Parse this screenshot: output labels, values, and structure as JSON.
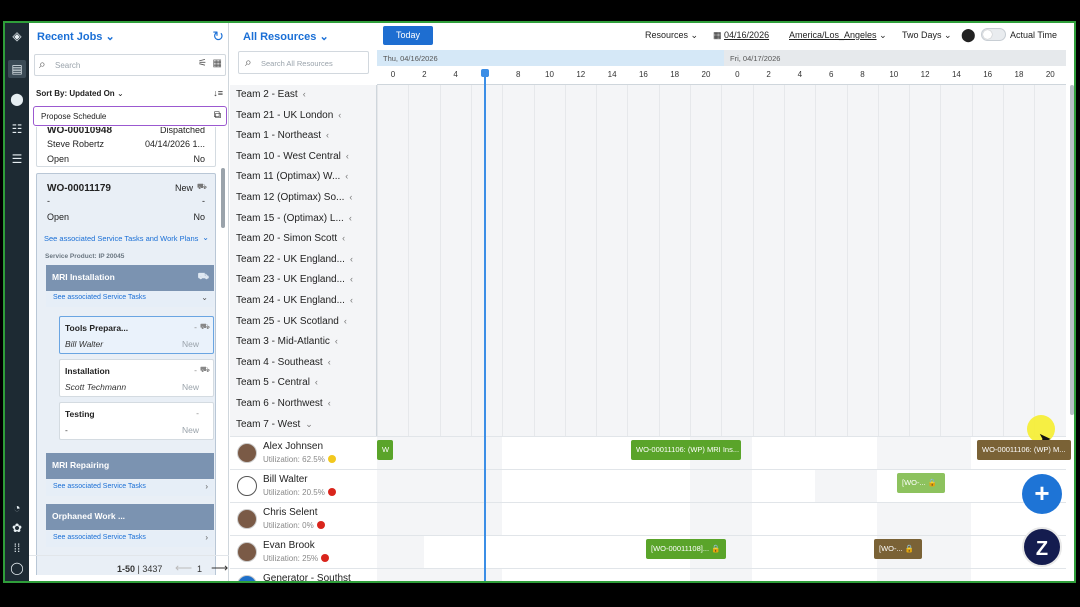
{
  "jobs_panel": {
    "title": "Recent Jobs",
    "search_placeholder": "Search",
    "sort_label": "Sort By:",
    "sort_value": "Updated On",
    "propose_label": "Propose Schedule",
    "jobs": [
      {
        "id": "WO-00010948",
        "status": "Dispatched",
        "person": "Steve Robertz",
        "date": "04/14/2026 1...",
        "state": "Open",
        "flag": "No"
      },
      {
        "id": "WO-00011179",
        "status": "New",
        "person": "-",
        "date": "-",
        "state": "Open",
        "flag": "No"
      }
    ],
    "see_tasks_plans": "See associated Service Tasks and Work Plans",
    "service_product": "Service Product: IP 20045",
    "groups": [
      {
        "name": "MRI Installation",
        "link": "See associated Service Tasks"
      },
      {
        "name": "MRI Repairing",
        "link": "See associated Service Tasks"
      },
      {
        "name": "Orphaned Work ...",
        "link": "See associated Service Tasks"
      }
    ],
    "tasks": [
      {
        "name": "Tools Prepara...",
        "dash": "-",
        "person": "Bill Walter",
        "status": "New"
      },
      {
        "name": "Installation",
        "dash": "-",
        "person": "Scott Techmann",
        "status": "New"
      },
      {
        "name": "Testing",
        "dash": "-",
        "person": "-",
        "status": "New"
      }
    ],
    "pagination": {
      "range": "1-50",
      "total": "3437",
      "page": "1"
    }
  },
  "schedule": {
    "title": "All Resources",
    "today_label": "Today",
    "resources_label": "Resources",
    "date": "04/16/2026",
    "timezone": "America/Los_Angeles",
    "view": "Two Days",
    "actual_time": "Actual Time",
    "search_placeholder": "Search All Resources",
    "day1": "Thu, 04/16/2026",
    "day2": "Fri, 04/17/2026",
    "hours": [
      "0",
      "2",
      "4",
      "6",
      "8",
      "10",
      "12",
      "14",
      "16",
      "18",
      "20",
      "0",
      "2",
      "4",
      "6",
      "8",
      "10",
      "12",
      "14",
      "16",
      "18",
      "20"
    ],
    "teams": [
      "Team 2 - East",
      "Team 21 - UK London",
      "Team 1 - Northeast",
      "Team 10 - West Central",
      "Team 11 (Optimax) W...",
      "Team 12 (Optimax) So...",
      "Team 15 - (Optimax) L...",
      "Team 20 - Simon Scott",
      "Team 22 - UK England...",
      "Team 23 - UK England...",
      "Team 24 - UK England...",
      "Team 25 - UK Scotland",
      "Team 3 - Mid-Atlantic",
      "Team 4 - Southeast",
      "Team 5 - Central",
      "Team 6 - Northwest",
      "Team 7 - West"
    ],
    "resources": [
      {
        "name": "Alex Johnsen",
        "util": "Utilization: 62.5%",
        "dot": "#f2c81e"
      },
      {
        "name": "Bill Walter",
        "util": "Utilization: 20.5%",
        "dot": "#d9251c"
      },
      {
        "name": "Chris Selent",
        "util": "Utilization: 0%",
        "dot": "#d9251c"
      },
      {
        "name": "Evan Brook",
        "util": "Utilization: 25%",
        "dot": "#d9251c"
      },
      {
        "name": "Generator - Southst",
        "util": "",
        "dot": ""
      }
    ],
    "bookings": {
      "w": "W",
      "b1": "WO-00011106: (WP) MRI Ins...",
      "b2": "WO-00011106: (WP) M...",
      "b3": "[WO-... 🔒",
      "b4": "[WO-00011108]... 🔒",
      "b5": "[WO-... 🔒"
    }
  },
  "colors": {
    "accent": "#1a6fd6",
    "frame": "#2f9e3a",
    "rail": "#1d2a33",
    "green": "#5aa42a",
    "brown": "#7a6236"
  }
}
